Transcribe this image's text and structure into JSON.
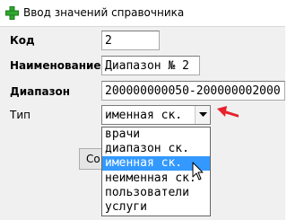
{
  "window": {
    "title": "Ввод значений справочника"
  },
  "form": {
    "code_label": "Код",
    "code_value": "2",
    "name_label": "Наименование",
    "name_value": "Диапазон № 2",
    "range_label": "Диапазон",
    "range_value": "200000000050-200000002000",
    "type_label": "Тип",
    "type_value": "именная ск."
  },
  "button_behind": {
    "label": "Со"
  },
  "dropdown": {
    "options": [
      "врачи",
      "диапазон ск.",
      "именная ск.",
      "неименная ск.",
      "пользователи",
      "услуги"
    ],
    "selected_index": 2
  },
  "colors": {
    "selection": "#3399ff",
    "annotation_arrow": "#e8212b",
    "title_icon": "#2fa82f"
  },
  "icons": {
    "title": "green-cross-icon",
    "combo": "chevron-down-icon",
    "annotation": "red-arrow-icon",
    "pointer": "mouse-cursor-icon"
  }
}
